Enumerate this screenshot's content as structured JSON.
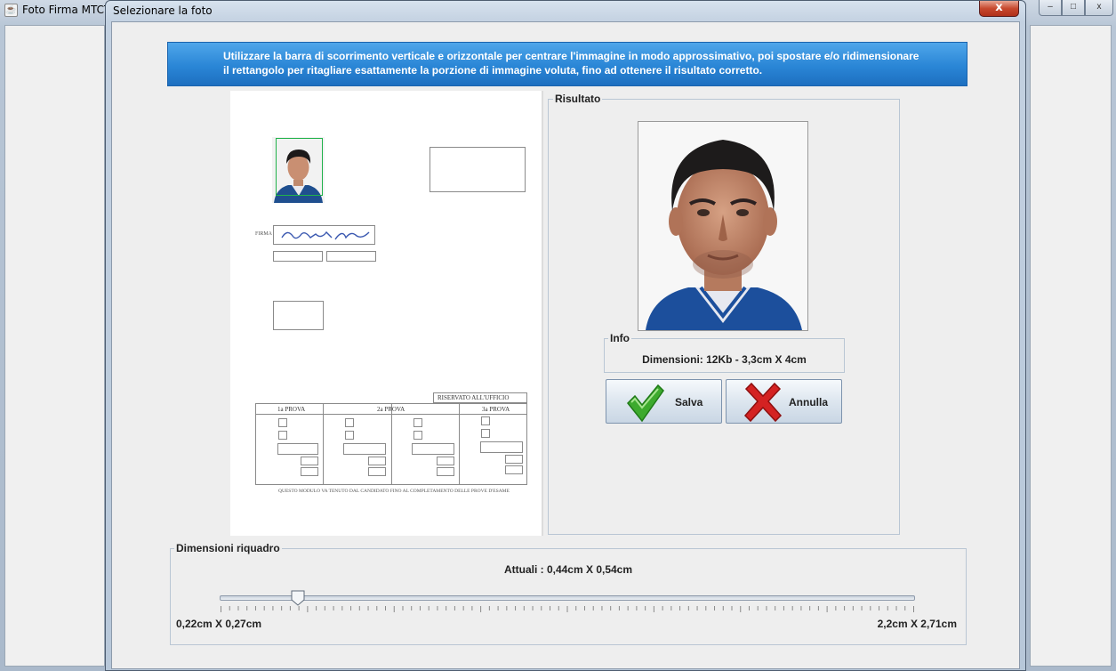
{
  "background_window": {
    "title": "Foto Firma MTCT",
    "app_icon": "java-cup-icon",
    "controls": {
      "minimize": "–",
      "maximize": "□",
      "close": "x"
    }
  },
  "dialog": {
    "title": "Selezionare la foto",
    "close_glyph": "x"
  },
  "banner": {
    "line_1": "Utilizzare la barra di scorrimento verticale e orizzontale per centrare l'immagine in modo approssimativo, poi spostare e/o ridimensionare",
    "line_2": "il rettangolo per ritagliare esattamente la porzione di immagine voluta, fino ad ottenere il risultato corretto.",
    "color": "#2a86d6"
  },
  "document": {
    "signature_label": "FIRMA",
    "reserved_header": "RISERVATO ALL'UFFICIO",
    "exam_columns": [
      "1a PROVA",
      "2a PROVA",
      "3a PROVA"
    ],
    "footer_note": "QUESTO MODULO VA TENUTO DAL CANDIDATO FINO AL COMPLETAMENTO DELLE PROVE D'ESAME",
    "crop_rectangle_color": "#21b24a"
  },
  "result": {
    "legend": "Risultato",
    "info_legend": "Info",
    "info_text": "Dimensioni: 12Kb - 3,3cm X 4cm",
    "save_label": "Salva",
    "cancel_label": "Annulla",
    "save_icon": "green-check-icon",
    "cancel_icon": "red-x-icon"
  },
  "dimensions": {
    "legend": "Dimensioni riquadro",
    "current": "Attuali : 0,44cm X 0,54cm",
    "min_label": "0,22cm X 0,27cm",
    "max_label": "2,2cm X 2,71cm",
    "slider_fraction": 0.113,
    "tick_count": 81
  }
}
